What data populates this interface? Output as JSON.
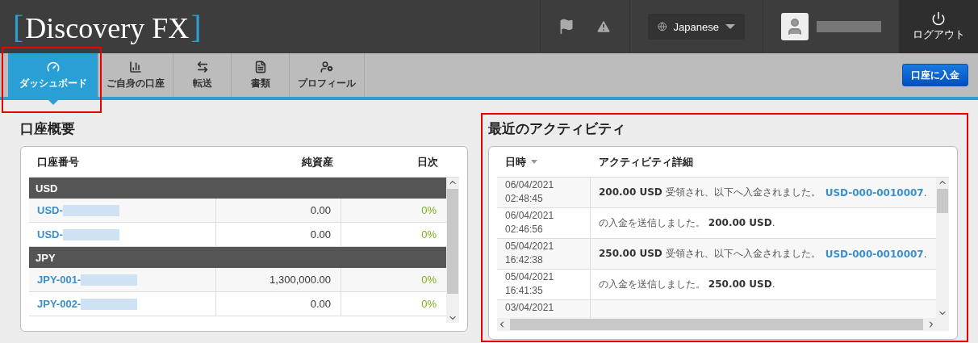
{
  "header": {
    "logo_open": "[",
    "logo": "Discovery FX",
    "logo_close": "]",
    "language": "Japanese",
    "logout": "ログアウト"
  },
  "nav": {
    "tabs": [
      {
        "label": "ダッシュボード",
        "kind": "gauge",
        "selected": true
      },
      {
        "label": "ご自身の口座",
        "kind": "chart",
        "selected": false
      },
      {
        "label": "転送",
        "kind": "transfer",
        "selected": false
      },
      {
        "label": "書類",
        "kind": "document",
        "selected": false
      },
      {
        "label": "プロフィール",
        "kind": "profile",
        "selected": false
      }
    ],
    "deposit_button": "口座に入金"
  },
  "accounts": {
    "title": "口座概要",
    "columns": [
      "口座番号",
      "純資産",
      "日次"
    ],
    "groups": [
      {
        "name": "USD",
        "rows": [
          {
            "account": "USD-",
            "balance": "0.00",
            "daily": "0%"
          },
          {
            "account": "USD-",
            "balance": "0.00",
            "daily": "0%"
          }
        ]
      },
      {
        "name": "JPY",
        "rows": [
          {
            "account": "JPY-001-",
            "balance": "1,300,000.00",
            "daily": "0%"
          },
          {
            "account": "JPY-002-",
            "balance": "0.00",
            "daily": "0%"
          }
        ]
      }
    ]
  },
  "activity": {
    "title": "最近のアクティビティ",
    "columns": [
      "日時",
      "アクティビティ詳細"
    ],
    "rows": [
      {
        "date": "06/04/2021",
        "time": "02:48:45",
        "detail": "**200.00 USD** 受領され、以下へ入金されました。",
        "link": "USD-000-0010007",
        "tail": "."
      },
      {
        "date": "06/04/2021",
        "time": "02:46:56",
        "detail": "の入金を送信しました。 **200.00 USD**."
      },
      {
        "date": "05/04/2021",
        "time": "16:42:38",
        "detail": "**250.00 USD** 受領され、以下へ入金されました。",
        "link": "USD-000-0010007",
        "tail": "."
      },
      {
        "date": "05/04/2021",
        "time": "16:41:35",
        "detail": "の入金を送信しました。 **250.00 USD**."
      },
      {
        "date": "03/04/2021"
      }
    ]
  }
}
